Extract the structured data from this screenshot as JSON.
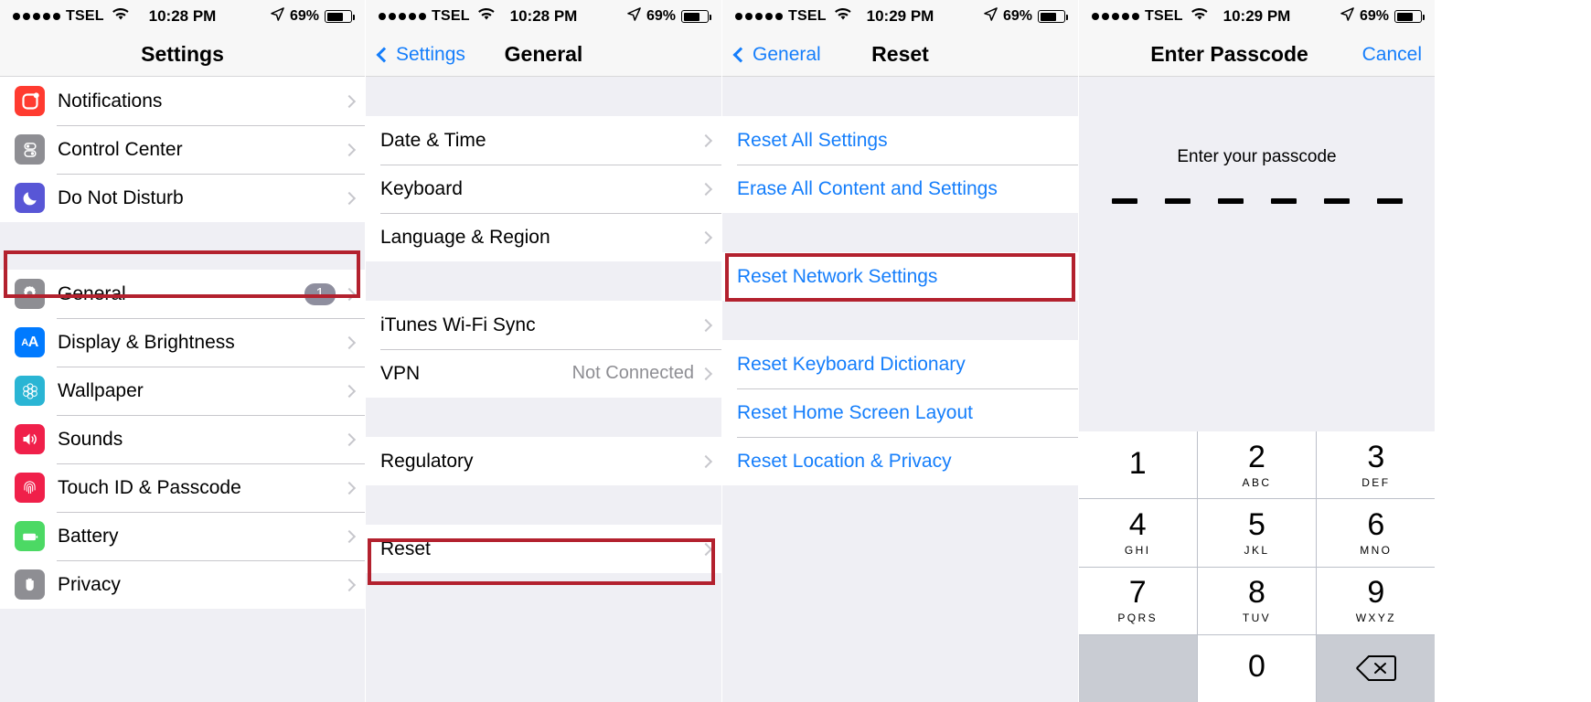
{
  "statusbar": {
    "carrier": "TSEL",
    "signal_dots": 5,
    "time_1": "10:28 PM",
    "time_2": "10:28 PM",
    "time_3": "10:29 PM",
    "time_4": "10:29 PM",
    "battery": "69%",
    "battery_level": 69,
    "location_icon": "location-arrow-icon",
    "wifi_icon": "wifi-icon"
  },
  "highlight_color": "#b3212e",
  "accent_color": "#157efb",
  "screen1": {
    "title": "Settings",
    "groups": [
      {
        "rows": [
          {
            "label": "Notifications",
            "icon": "notifications-icon",
            "icon_color": "#ff3b30"
          },
          {
            "label": "Control Center",
            "icon": "control-center-icon",
            "icon_color": "#8e8e93"
          },
          {
            "label": "Do Not Disturb",
            "icon": "do-not-disturb-icon",
            "icon_color": "#5856d6"
          }
        ]
      },
      {
        "rows": [
          {
            "label": "General",
            "icon": "gear-icon",
            "icon_color": "#8e8e93",
            "badge": "1",
            "highlighted": true
          },
          {
            "label": "Display & Brightness",
            "icon": "display-brightness-icon",
            "icon_color": "#007aff"
          },
          {
            "label": "Wallpaper",
            "icon": "wallpaper-icon",
            "icon_color": "#2ab5d4"
          },
          {
            "label": "Sounds",
            "icon": "sounds-icon",
            "icon_color": "#f0204a"
          },
          {
            "label": "Touch ID & Passcode",
            "icon": "touch-id-icon",
            "icon_color": "#f0204a"
          },
          {
            "label": "Battery",
            "icon": "battery-icon",
            "icon_color": "#4cd964"
          },
          {
            "label": "Privacy",
            "icon": "privacy-hand-icon",
            "icon_color": "#8e8e93"
          }
        ]
      }
    ]
  },
  "screen2": {
    "title": "General",
    "back_label": "Settings",
    "groups": [
      {
        "rows": [
          {
            "label": "Date & Time"
          },
          {
            "label": "Keyboard"
          },
          {
            "label": "Language & Region"
          }
        ]
      },
      {
        "rows": [
          {
            "label": "iTunes Wi-Fi Sync"
          },
          {
            "label": "VPN",
            "value": "Not Connected"
          }
        ]
      },
      {
        "rows": [
          {
            "label": "Regulatory"
          }
        ]
      },
      {
        "rows": [
          {
            "label": "Reset",
            "highlighted": true
          }
        ]
      }
    ]
  },
  "screen3": {
    "title": "Reset",
    "back_label": "General",
    "groups": [
      {
        "rows": [
          {
            "label": "Reset All Settings",
            "blue": true
          },
          {
            "label": "Erase All Content and Settings",
            "blue": true
          }
        ]
      },
      {
        "rows": [
          {
            "label": "Reset Network Settings",
            "blue": true,
            "highlighted": true
          }
        ]
      },
      {
        "rows": [
          {
            "label": "Reset Keyboard Dictionary",
            "blue": true
          },
          {
            "label": "Reset Home Screen Layout",
            "blue": true
          },
          {
            "label": "Reset Location & Privacy",
            "blue": true
          }
        ]
      }
    ]
  },
  "screen4": {
    "title": "Enter Passcode",
    "cancel_label": "Cancel",
    "prompt": "Enter your passcode",
    "passcode_length": 6,
    "keypad": [
      {
        "num": "1",
        "letters": ""
      },
      {
        "num": "2",
        "letters": "ABC"
      },
      {
        "num": "3",
        "letters": "DEF"
      },
      {
        "num": "4",
        "letters": "GHI"
      },
      {
        "num": "5",
        "letters": "JKL"
      },
      {
        "num": "6",
        "letters": "MNO"
      },
      {
        "num": "7",
        "letters": "PQRS"
      },
      {
        "num": "8",
        "letters": "TUV"
      },
      {
        "num": "9",
        "letters": "WXYZ"
      },
      {
        "num": "",
        "letters": "",
        "blank": true
      },
      {
        "num": "0",
        "letters": ""
      },
      {
        "num": "",
        "letters": "",
        "delete": true,
        "icon": "delete-backspace-icon"
      }
    ]
  }
}
